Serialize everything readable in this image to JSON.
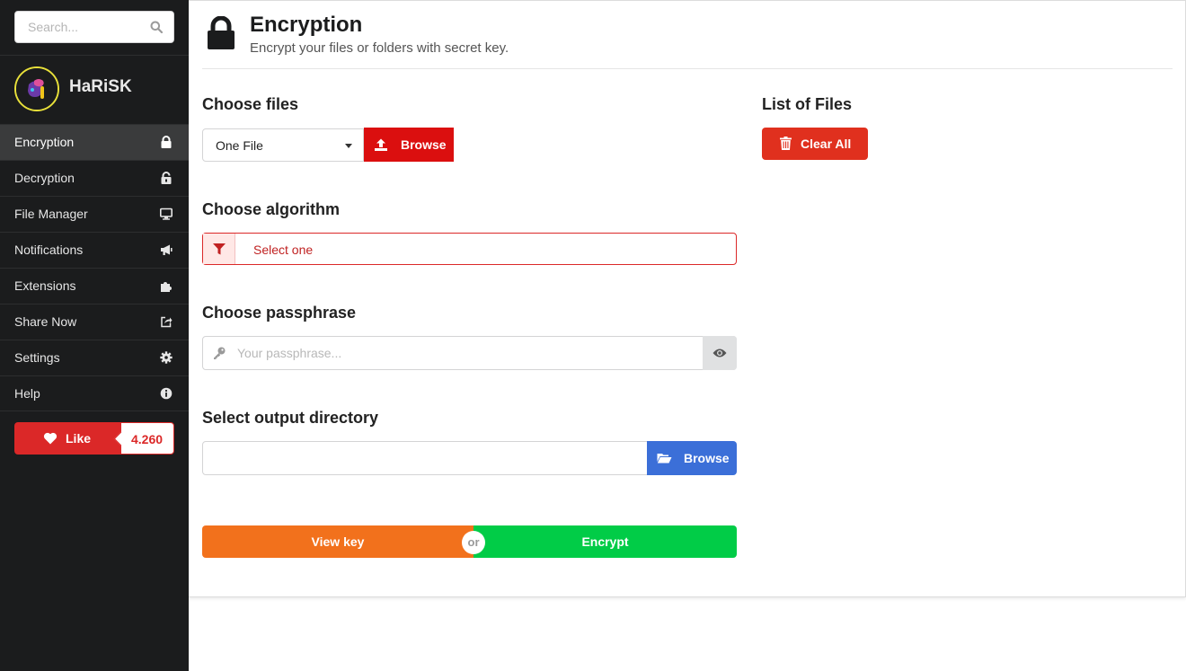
{
  "search": {
    "placeholder": "Search..."
  },
  "profile": {
    "name": "HaRiSK"
  },
  "sidebar": {
    "items": [
      {
        "label": "Encryption",
        "icon": "lock-icon",
        "active": true
      },
      {
        "label": "Decryption",
        "icon": "unlock-icon",
        "active": false
      },
      {
        "label": "File Manager",
        "icon": "monitor-icon",
        "active": false
      },
      {
        "label": "Notifications",
        "icon": "bullhorn-icon",
        "active": false
      },
      {
        "label": "Extensions",
        "icon": "puzzle-icon",
        "active": false
      },
      {
        "label": "Share Now",
        "icon": "share-icon",
        "active": false
      },
      {
        "label": "Settings",
        "icon": "gear-icon",
        "active": false
      },
      {
        "label": "Help",
        "icon": "info-icon",
        "active": false
      }
    ],
    "like": {
      "label": "Like",
      "count": "4.260"
    }
  },
  "header": {
    "title": "Encryption",
    "subtitle": "Encrypt your files or folders with secret key."
  },
  "files": {
    "title": "Choose files",
    "selected": "One File",
    "browse_label": "Browse"
  },
  "algorithm": {
    "title": "Choose algorithm",
    "placeholder": "Select one"
  },
  "passphrase": {
    "title": "Choose passphrase",
    "placeholder": "Your passphrase..."
  },
  "output": {
    "title": "Select output directory",
    "value": "",
    "browse_label": "Browse"
  },
  "actions": {
    "view_key": "View key",
    "or": "or",
    "encrypt": "Encrypt"
  },
  "list": {
    "title": "List of Files",
    "clear_label": "Clear All"
  },
  "colors": {
    "sidebar_bg": "#1b1c1d",
    "danger": "#db2828",
    "blue": "#3b6fd8",
    "orange": "#f2711c",
    "green": "#01cc47"
  }
}
